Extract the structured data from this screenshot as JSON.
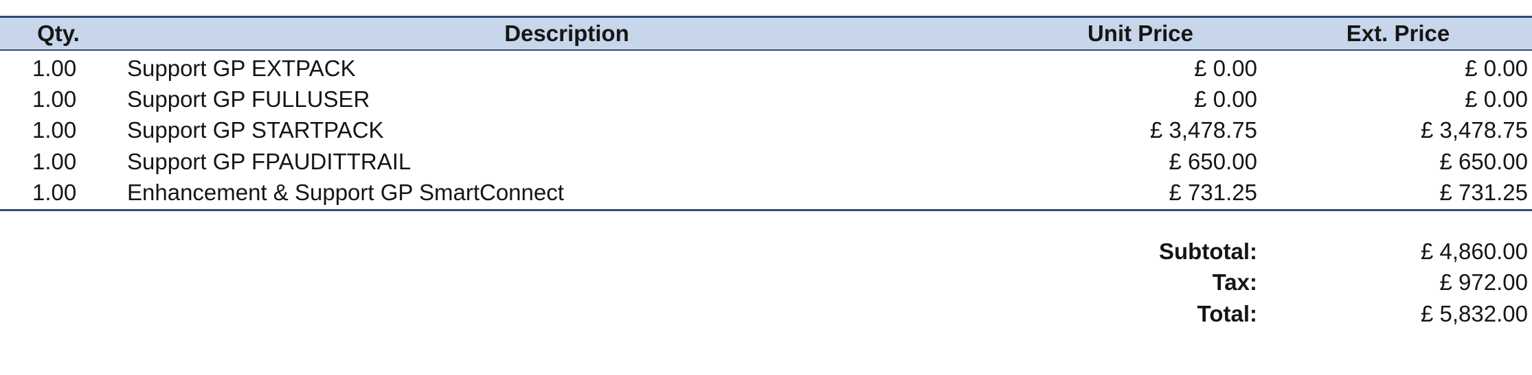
{
  "table": {
    "headers": {
      "qty": "Qty.",
      "description": "Description",
      "unit_price": "Unit Price",
      "ext_price": "Ext. Price"
    },
    "rows": [
      {
        "qty": "1.00",
        "description": "Support GP EXTPACK",
        "unit_price": "£ 0.00",
        "ext_price": "£ 0.00"
      },
      {
        "qty": "1.00",
        "description": "Support GP FULLUSER",
        "unit_price": "£ 0.00",
        "ext_price": "£ 0.00"
      },
      {
        "qty": "1.00",
        "description": "Support GP STARTPACK",
        "unit_price": "£ 3,478.75",
        "ext_price": "£ 3,478.75"
      },
      {
        "qty": "1.00",
        "description": "Support GP FPAUDITTRAIL",
        "unit_price": "£ 650.00",
        "ext_price": "£ 650.00"
      },
      {
        "qty": "1.00",
        "description": "Enhancement & Support GP SmartConnect",
        "unit_price": "£ 731.25",
        "ext_price": "£ 731.25"
      }
    ]
  },
  "totals": {
    "subtotal_label": "Subtotal:",
    "subtotal_value": "£ 4,860.00",
    "tax_label": "Tax:",
    "tax_value": "£ 972.00",
    "total_label": "Total:",
    "total_value": "£ 5,832.00"
  },
  "colors": {
    "header_background": "#c7d6ea",
    "rule_color": "#2f4a73"
  }
}
